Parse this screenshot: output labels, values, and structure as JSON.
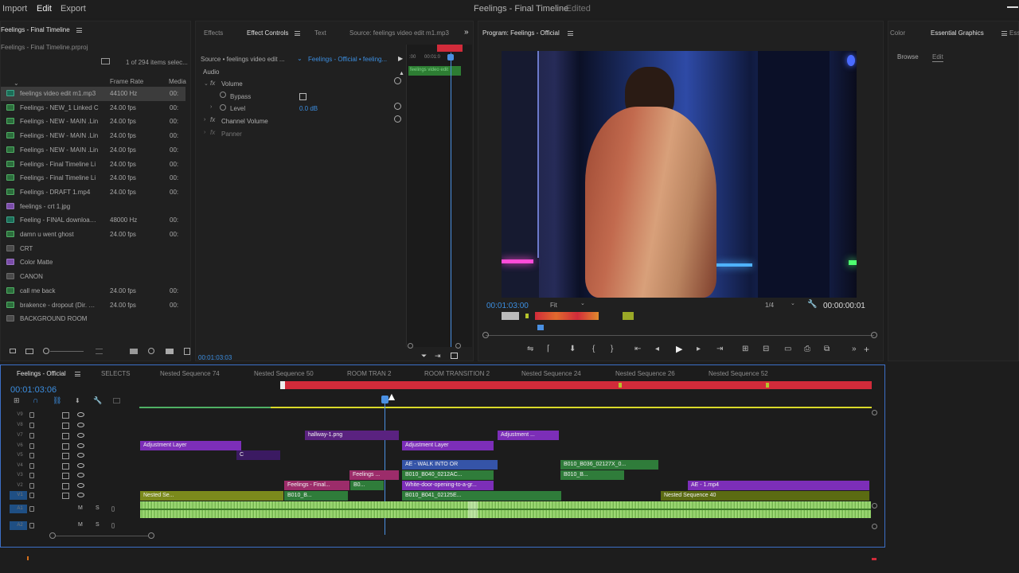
{
  "menu": {
    "import": "Import",
    "edit": "Edit",
    "export": "Export"
  },
  "window_title": "Feelings - Final Timeline",
  "window_status": "- Edited",
  "project": {
    "tab": "Feelings - Final Timeline",
    "file": "Feelings - Final Timeline.prproj",
    "count": "1 of 294 items selec...",
    "col_framerate": "Frame Rate",
    "col_media": "Media",
    "items": [
      {
        "name": "feelings video edit m1.mp3",
        "rate": "44100 Hz",
        "media": "00:",
        "type": "aud",
        "selected": true
      },
      {
        "name": "Feelings - NEW_1 Linked C",
        "rate": "24.00 fps",
        "media": "00:",
        "type": "seq"
      },
      {
        "name": "Feelings - NEW - MAIN .Lin",
        "rate": "24.00 fps",
        "media": "00:",
        "type": "seq"
      },
      {
        "name": "Feelings - NEW - MAIN .Lin",
        "rate": "24.00 fps",
        "media": "00:",
        "type": "seq"
      },
      {
        "name": "Feelings - NEW - MAIN .Lin",
        "rate": "24.00 fps",
        "media": "00:",
        "type": "seq"
      },
      {
        "name": "Feelings - Final Timeline Li",
        "rate": "24.00 fps",
        "media": "00:",
        "type": "seq"
      },
      {
        "name": "Feelings - Final Timeline Li",
        "rate": "24.00 fps",
        "media": "00:",
        "type": "seq"
      },
      {
        "name": "Feelings - DRAFT 1.mp4",
        "rate": "24.00 fps",
        "media": "00:",
        "type": "seq"
      },
      {
        "name": "feelings - crt 1.jpg",
        "rate": "",
        "media": "",
        "type": "img"
      },
      {
        "name": "Feeling - FINAL downloaded",
        "rate": "48000 Hz",
        "media": "00:",
        "type": "aud"
      },
      {
        "name": "damn u went ghost",
        "rate": "24.00 fps",
        "media": "00:",
        "type": "seq"
      },
      {
        "name": "CRT",
        "rate": "",
        "media": "",
        "type": "bin"
      },
      {
        "name": "Color Matte",
        "rate": "",
        "media": "",
        "type": "img"
      },
      {
        "name": "CANON",
        "rate": "",
        "media": "",
        "type": "bin"
      },
      {
        "name": "call me back",
        "rate": "24.00 fps",
        "media": "00:",
        "type": "seq"
      },
      {
        "name": "brakence - dropout (Dir. @D",
        "rate": "24.00 fps",
        "media": "00:",
        "type": "seq"
      },
      {
        "name": "BACKGROUND ROOM",
        "rate": "",
        "media": "",
        "type": "bin"
      }
    ]
  },
  "effects_panel": {
    "tabs": [
      "Effects",
      "Effect Controls",
      "Text",
      "Source: feelings video edit m1.mp3"
    ],
    "source_label": "Source • feelings video edit ...",
    "seq_label": "Feelings - Official • feeling...",
    "audio": "Audio",
    "volume": "Volume",
    "bypass": "Bypass",
    "level": "Level",
    "level_value": "0.0 dB",
    "channel_volume": "Channel Volume",
    "panner": "Panner",
    "clip_name": "feelings video edit",
    "time_start": ":00",
    "time_mark": "00:01:0",
    "timecode": "00:01:03:03"
  },
  "program": {
    "title": "Program: Feelings - Official",
    "timecode": "00:01:03:00",
    "fit": "Fit",
    "resolution": "1/4",
    "duration": "00:00:00:01"
  },
  "right_panel": {
    "tabs": [
      "Color",
      "Essential Graphics",
      "Esse"
    ],
    "browse": "Browse",
    "edit": "Edit"
  },
  "timeline": {
    "tabs": [
      "Feelings - Official",
      "SELECTS",
      "Nested Sequence 74",
      "Nested Sequence 50",
      "ROOM TRAN 2",
      "ROOM TRANSITION 2",
      "Nested Sequence 24",
      "Nested Sequence 26",
      "Nested Sequence 52"
    ],
    "timecode": "00:01:03:06",
    "tracks": [
      "V9",
      "V8",
      "V7",
      "V6",
      "V5",
      "V4",
      "V3",
      "V2",
      "V1",
      "A1",
      "A2"
    ],
    "audio_m": "M",
    "audio_s": "S",
    "clips": {
      "hallway": "hallway-1.png",
      "adj1": "Adjustment Layer",
      "adj2": "Adjustment Layer",
      "adj3": "Adjustment ...",
      "c": "C",
      "walk": "AE - WALK INTO OR",
      "b036": "B010_B036_02127X_0...",
      "b036b": "B010_B...",
      "feelings_small": "Feelings ...",
      "b0": "B0...",
      "b040": "B010_B040_0212AC...",
      "feelings_final": "Feelings - Final...",
      "white_door": "White-door-opening-to-a-gr...",
      "ae1": "AE - 1.mp4",
      "nested_se": "Nested Se...",
      "b010b": "B010_B...",
      "b041": "B010_B041_02125E...",
      "nested40": "Nested Sequence 40",
      "fx": "fx"
    }
  },
  "colors": {
    "accent": "#2d8ceb",
    "work_area": "#d12b3a",
    "playhead": "#4a90e2"
  }
}
